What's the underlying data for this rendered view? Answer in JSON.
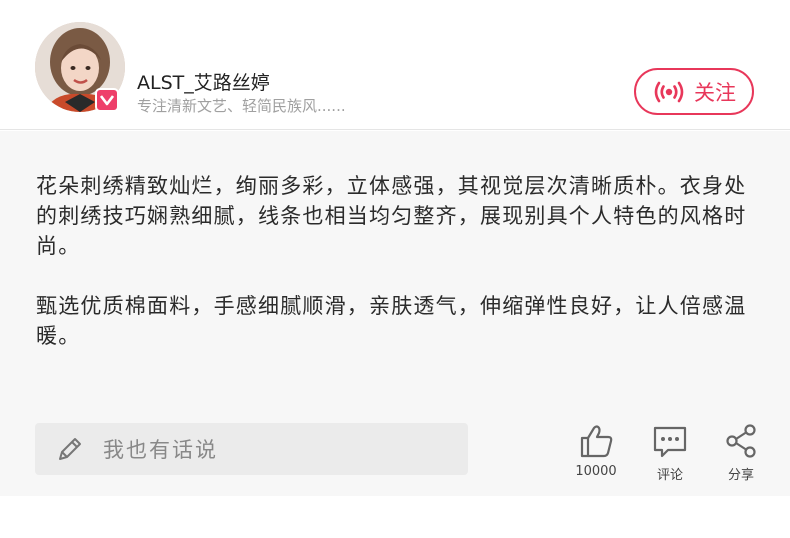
{
  "header": {
    "username": "ALST_艾路丝婷",
    "bio": "专注清新文艺、轻简民族风......",
    "follow_label": "关注"
  },
  "content": {
    "paragraph1": "花朵刺绣精致灿烂，绚丽多彩，立体感强，其视觉层次清晰质朴。衣身处的刺绣技巧娴熟细腻，线条也相当均匀整齐，展现别具个人特色的风格时尚。",
    "paragraph2": "甄选优质棉面料，手感细腻顺滑，亲肤透气，伸缩弹性良好，让人倍感温暖。"
  },
  "footer": {
    "comment_placeholder": "我也有话说",
    "like_count": "10000",
    "comment_label": "评论",
    "share_label": "分享"
  },
  "colors": {
    "accent": "#e8375a",
    "badge": "#ee3f6a",
    "content_bg": "#f7f7f7"
  }
}
